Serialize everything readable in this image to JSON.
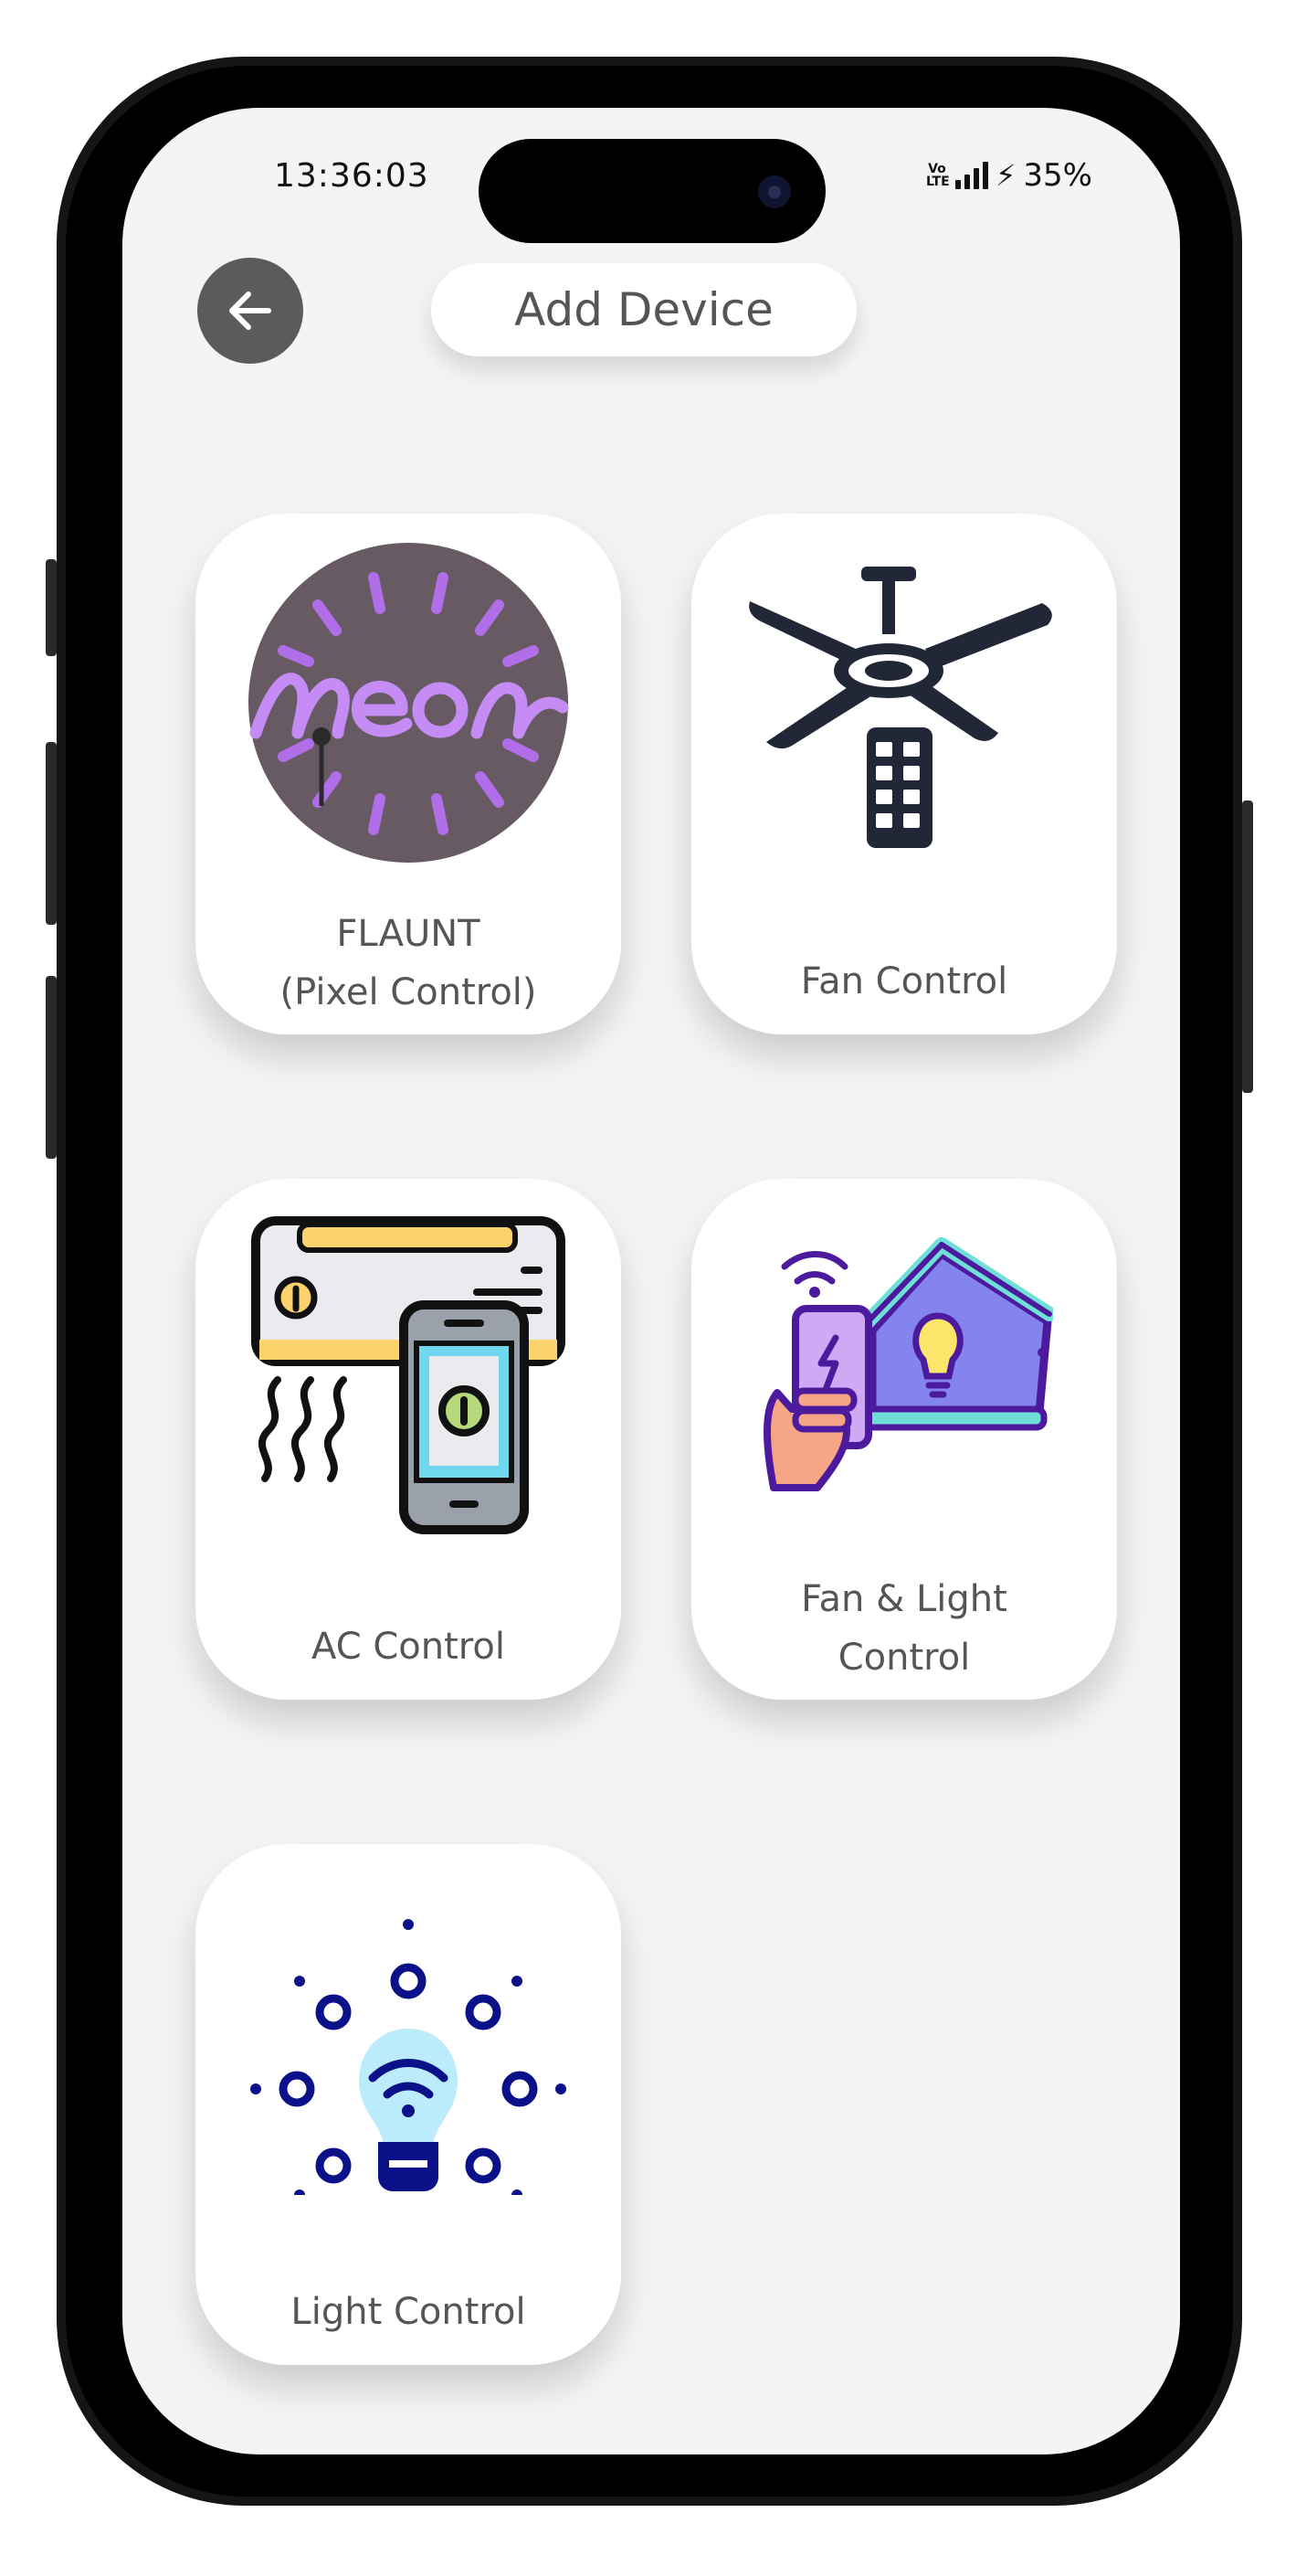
{
  "status_bar": {
    "time": "13:36:03",
    "network": "Vo LTE",
    "battery": "35%"
  },
  "header": {
    "back_icon": "arrow-left-icon",
    "title": "Add Device"
  },
  "devices": [
    {
      "label_line1": "FLAUNT",
      "label_line2": "(Pixel Control)",
      "icon": "neon-sign-icon"
    },
    {
      "label_line1": "Fan Control",
      "icon": "ceiling-fan-remote-icon"
    },
    {
      "label_line1": "AC Control",
      "icon": "ac-phone-control-icon"
    },
    {
      "label_line1": "Fan & Light",
      "label_line2": "Control",
      "icon": "smart-home-phone-icon"
    },
    {
      "label_line1": "Light Control",
      "icon": "smart-bulb-icon"
    }
  ],
  "colors": {
    "background": "#f4f4f4",
    "card": "#ffffff",
    "back_button": "#5b5b5b",
    "label_text": "#555555",
    "neon_purple": "#b06ee8",
    "bulb_navy": "#0a1189"
  }
}
